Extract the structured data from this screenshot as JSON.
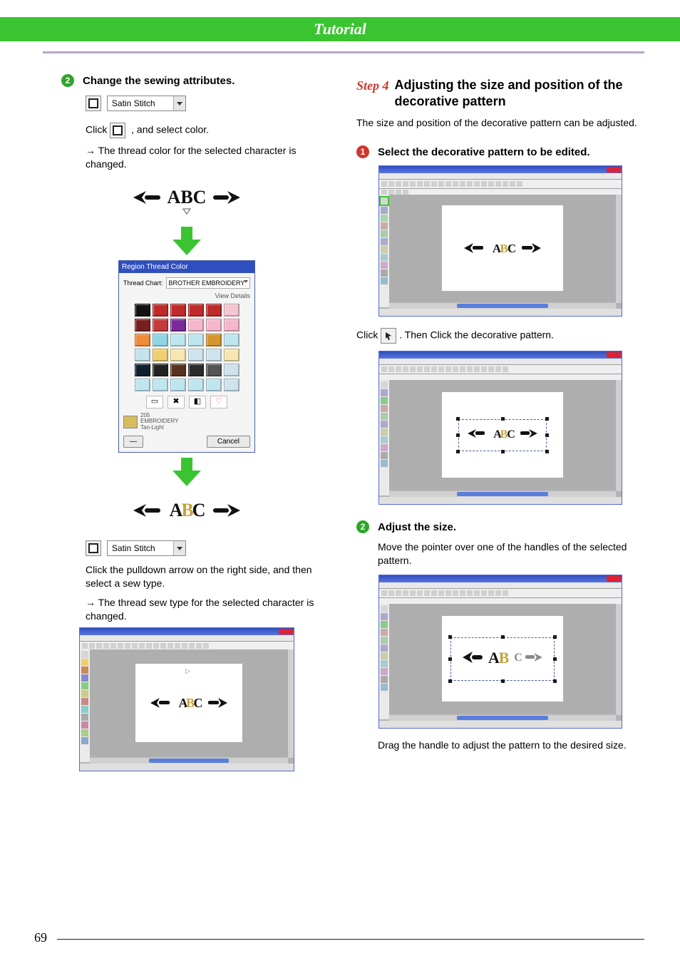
{
  "page_title": "Tutorial",
  "page_number": "69",
  "left": {
    "step2": {
      "badge": "2",
      "heading": "Change the sewing attributes.",
      "dropdown_label": "Satin Stitch",
      "click_text_prefix": "Click ",
      "click_text_suffix": " , and select color.",
      "arrow_line_1": "→ The thread color for the selected character is changed.",
      "deco_text": "ABC",
      "color_dialog": {
        "title": "Region Thread Color",
        "chart_label": "Thread Chart:",
        "chart_value": "BROTHER EMBROIDERY",
        "view_details": "View Details",
        "selected_code": "205",
        "selected_name_a": "EMBROIDERY",
        "selected_name_b": "Tan-Light",
        "ok_button": "—",
        "cancel_button": "Cancel",
        "swatches": [
          "#111111",
          "#bf2b2b",
          "#bf2b2b",
          "#bf2b2b",
          "#bf2b2b",
          "#f3c6d1",
          "#7a1f1f",
          "#c43a3a",
          "#7a2b9a",
          "#f6b6cc",
          "#f6b6cc",
          "#f6b6cc",
          "#f08b3a",
          "#8fd5e6",
          "#bfe6ee",
          "#bfe6ee",
          "#d6952e",
          "#bfe6ee",
          "#c4e3ec",
          "#f0cf72",
          "#f6e7b0",
          "#cfe3ec",
          "#cfe3ec",
          "#f6e7b0",
          "#0f1f2f",
          "#222222",
          "#5a331f",
          "#2b2b2b",
          "#555555",
          "#cfe3ec",
          "#bfe6ee",
          "#bfe6ee",
          "#bfe6ee",
          "#bfe6ee",
          "#bfe6ee",
          "#cfe3ec"
        ]
      },
      "dropdown2_label": "Satin Stitch",
      "pulldown_text": "Click the pulldown arrow on the right side, and then select a sew type.",
      "arrow_line_2": "→ The thread sew type for the selected character is changed."
    }
  },
  "right": {
    "step4": {
      "label": "Step 4",
      "heading": "Adjusting the size and position of the decorative pattern",
      "intro": "The size and position of the decorative pattern can be adjusted."
    },
    "step1": {
      "badge": "1",
      "heading": "Select the decorative pattern to be edited.",
      "click_prefix": "Click ",
      "click_suffix": " . Then Click the decorative pattern."
    },
    "step2": {
      "badge": "2",
      "heading": "Adjust the size.",
      "move_text": "Move the pointer over one of the handles of the selected pattern.",
      "drag_text": "Drag the handle to adjust the pattern to the desired size."
    }
  },
  "icons": {
    "fill_square": "fill-square-icon",
    "pointer": "pointer-icon",
    "heart": "♡"
  }
}
